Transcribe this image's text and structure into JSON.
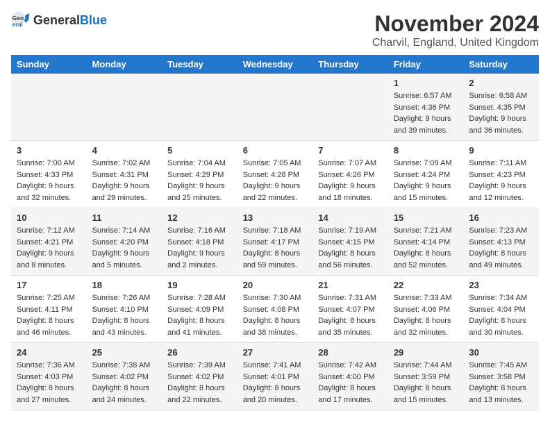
{
  "header": {
    "logo_general": "General",
    "logo_blue": "Blue",
    "month": "November 2024",
    "location": "Charvil, England, United Kingdom"
  },
  "days_of_week": [
    "Sunday",
    "Monday",
    "Tuesday",
    "Wednesday",
    "Thursday",
    "Friday",
    "Saturday"
  ],
  "weeks": [
    [
      {
        "day": "",
        "info": ""
      },
      {
        "day": "",
        "info": ""
      },
      {
        "day": "",
        "info": ""
      },
      {
        "day": "",
        "info": ""
      },
      {
        "day": "",
        "info": ""
      },
      {
        "day": "1",
        "info": "Sunrise: 6:57 AM\nSunset: 4:36 PM\nDaylight: 9 hours and 39 minutes."
      },
      {
        "day": "2",
        "info": "Sunrise: 6:58 AM\nSunset: 4:35 PM\nDaylight: 9 hours and 36 minutes."
      }
    ],
    [
      {
        "day": "3",
        "info": "Sunrise: 7:00 AM\nSunset: 4:33 PM\nDaylight: 9 hours and 32 minutes."
      },
      {
        "day": "4",
        "info": "Sunrise: 7:02 AM\nSunset: 4:31 PM\nDaylight: 9 hours and 29 minutes."
      },
      {
        "day": "5",
        "info": "Sunrise: 7:04 AM\nSunset: 4:29 PM\nDaylight: 9 hours and 25 minutes."
      },
      {
        "day": "6",
        "info": "Sunrise: 7:05 AM\nSunset: 4:28 PM\nDaylight: 9 hours and 22 minutes."
      },
      {
        "day": "7",
        "info": "Sunrise: 7:07 AM\nSunset: 4:26 PM\nDaylight: 9 hours and 18 minutes."
      },
      {
        "day": "8",
        "info": "Sunrise: 7:09 AM\nSunset: 4:24 PM\nDaylight: 9 hours and 15 minutes."
      },
      {
        "day": "9",
        "info": "Sunrise: 7:11 AM\nSunset: 4:23 PM\nDaylight: 9 hours and 12 minutes."
      }
    ],
    [
      {
        "day": "10",
        "info": "Sunrise: 7:12 AM\nSunset: 4:21 PM\nDaylight: 9 hours and 8 minutes."
      },
      {
        "day": "11",
        "info": "Sunrise: 7:14 AM\nSunset: 4:20 PM\nDaylight: 9 hours and 5 minutes."
      },
      {
        "day": "12",
        "info": "Sunrise: 7:16 AM\nSunset: 4:18 PM\nDaylight: 9 hours and 2 minutes."
      },
      {
        "day": "13",
        "info": "Sunrise: 7:18 AM\nSunset: 4:17 PM\nDaylight: 8 hours and 59 minutes."
      },
      {
        "day": "14",
        "info": "Sunrise: 7:19 AM\nSunset: 4:15 PM\nDaylight: 8 hours and 56 minutes."
      },
      {
        "day": "15",
        "info": "Sunrise: 7:21 AM\nSunset: 4:14 PM\nDaylight: 8 hours and 52 minutes."
      },
      {
        "day": "16",
        "info": "Sunrise: 7:23 AM\nSunset: 4:13 PM\nDaylight: 8 hours and 49 minutes."
      }
    ],
    [
      {
        "day": "17",
        "info": "Sunrise: 7:25 AM\nSunset: 4:11 PM\nDaylight: 8 hours and 46 minutes."
      },
      {
        "day": "18",
        "info": "Sunrise: 7:26 AM\nSunset: 4:10 PM\nDaylight: 8 hours and 43 minutes."
      },
      {
        "day": "19",
        "info": "Sunrise: 7:28 AM\nSunset: 4:09 PM\nDaylight: 8 hours and 41 minutes."
      },
      {
        "day": "20",
        "info": "Sunrise: 7:30 AM\nSunset: 4:08 PM\nDaylight: 8 hours and 38 minutes."
      },
      {
        "day": "21",
        "info": "Sunrise: 7:31 AM\nSunset: 4:07 PM\nDaylight: 8 hours and 35 minutes."
      },
      {
        "day": "22",
        "info": "Sunrise: 7:33 AM\nSunset: 4:06 PM\nDaylight: 8 hours and 32 minutes."
      },
      {
        "day": "23",
        "info": "Sunrise: 7:34 AM\nSunset: 4:04 PM\nDaylight: 8 hours and 30 minutes."
      }
    ],
    [
      {
        "day": "24",
        "info": "Sunrise: 7:36 AM\nSunset: 4:03 PM\nDaylight: 8 hours and 27 minutes."
      },
      {
        "day": "25",
        "info": "Sunrise: 7:38 AM\nSunset: 4:02 PM\nDaylight: 8 hours and 24 minutes."
      },
      {
        "day": "26",
        "info": "Sunrise: 7:39 AM\nSunset: 4:02 PM\nDaylight: 8 hours and 22 minutes."
      },
      {
        "day": "27",
        "info": "Sunrise: 7:41 AM\nSunset: 4:01 PM\nDaylight: 8 hours and 20 minutes."
      },
      {
        "day": "28",
        "info": "Sunrise: 7:42 AM\nSunset: 4:00 PM\nDaylight: 8 hours and 17 minutes."
      },
      {
        "day": "29",
        "info": "Sunrise: 7:44 AM\nSunset: 3:59 PM\nDaylight: 8 hours and 15 minutes."
      },
      {
        "day": "30",
        "info": "Sunrise: 7:45 AM\nSunset: 3:58 PM\nDaylight: 8 hours and 13 minutes."
      }
    ]
  ]
}
